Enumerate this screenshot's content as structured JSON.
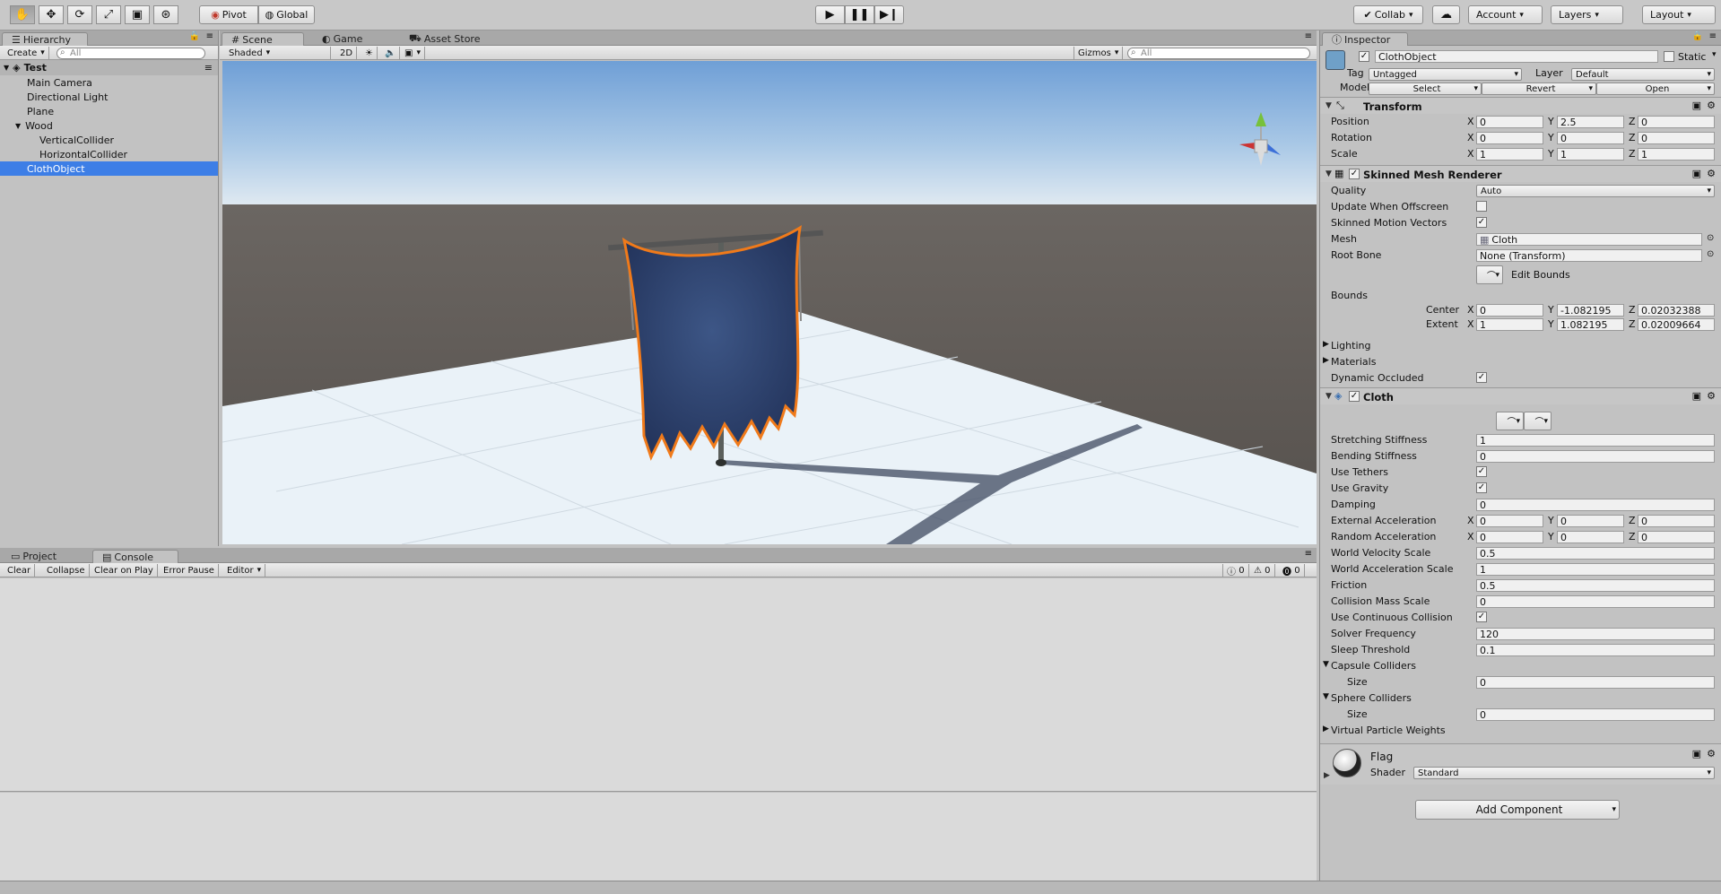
{
  "toolbar": {
    "tools": [
      "hand-tool",
      "move-tool",
      "rotate-tool",
      "scale-tool",
      "rect-tool",
      "transform-tool"
    ],
    "pivot_label": "Pivot",
    "global_label": "Global",
    "collab_label": "Collab",
    "account_label": "Account",
    "layers_label": "Layers",
    "layout_label": "Layout"
  },
  "hierarchy": {
    "tab_label": "Hierarchy",
    "create_label": "Create",
    "search_placeholder": "All",
    "scene_name": "Test",
    "items": [
      {
        "label": "Main Camera"
      },
      {
        "label": "Directional Light"
      },
      {
        "label": "Plane"
      },
      {
        "label": "Wood"
      },
      {
        "label": "VerticalCollider"
      },
      {
        "label": "HorizontalCollider"
      },
      {
        "label": "ClothObject"
      }
    ]
  },
  "scene_view": {
    "tabs": [
      {
        "label": "Scene"
      },
      {
        "label": "Game"
      },
      {
        "label": "Asset Store"
      }
    ],
    "shading_mode": "Shaded",
    "mode_2d": "2D",
    "gizmos_label": "Gizmos",
    "search_placeholder": "All",
    "gizmo_axes": [
      "x",
      "y",
      "z"
    ]
  },
  "bottom": {
    "tabs": [
      {
        "label": "Project"
      },
      {
        "label": "Console"
      }
    ],
    "buttons": {
      "clear": "Clear",
      "collapse": "Collapse",
      "clear_on_play": "Clear on Play",
      "error_pause": "Error Pause",
      "editor": "Editor"
    },
    "counts": {
      "info": "0",
      "warning": "0",
      "error": "0"
    }
  },
  "inspector": {
    "tab_label": "Inspector",
    "object_name": "ClothObject",
    "static_label": "Static",
    "tag_label": "Tag",
    "tag_value": "Untagged",
    "layer_label": "Layer",
    "layer_value": "Default",
    "model_label": "Model",
    "model_buttons": {
      "select": "Select",
      "revert": "Revert",
      "open": "Open"
    },
    "transform": {
      "title": "Transform",
      "position_label": "Position",
      "position": {
        "x": "0",
        "y": "2.5",
        "z": "0"
      },
      "rotation_label": "Rotation",
      "rotation": {
        "x": "0",
        "y": "0",
        "z": "0"
      },
      "scale_label": "Scale",
      "scale": {
        "x": "1",
        "y": "1",
        "z": "1"
      }
    },
    "skinned_mesh_renderer": {
      "title": "Skinned Mesh Renderer",
      "quality_label": "Quality",
      "quality_value": "Auto",
      "update_offscreen_label": "Update When Offscreen",
      "update_offscreen": "",
      "motion_vectors_label": "Skinned Motion Vectors",
      "motion_vectors": "✓",
      "mesh_label": "Mesh",
      "mesh_value": "Cloth",
      "root_bone_label": "Root Bone",
      "root_bone_value": "None (Transform)",
      "edit_bounds_label": "Edit Bounds",
      "bounds_label": "Bounds",
      "center_label": "Center",
      "center": {
        "x": "0",
        "y": "-1.082195",
        "z": "0.02032388"
      },
      "extent_label": "Extent",
      "extent": {
        "x": "1",
        "y": "1.082195",
        "z": "0.02009664"
      },
      "lighting_label": "Lighting",
      "materials_label": "Materials",
      "dynamic_occluded_label": "Dynamic Occluded",
      "dynamic_occluded": "✓"
    },
    "cloth": {
      "title": "Cloth",
      "stretching_label": "Stretching Stiffness",
      "stretching": "1",
      "bending_label": "Bending Stiffness",
      "bending": "0",
      "use_tethers_label": "Use Tethers",
      "use_tethers": "✓",
      "use_gravity_label": "Use Gravity",
      "use_gravity": "✓",
      "damping_label": "Damping",
      "damping": "0",
      "ext_accel_label": "External Acceleration",
      "ext_accel": {
        "x": "0",
        "y": "0",
        "z": "0"
      },
      "rand_accel_label": "Random Acceleration",
      "rand_accel": {
        "x": "0",
        "y": "0",
        "z": "0"
      },
      "world_vel_label": "World Velocity Scale",
      "world_vel": "0.5",
      "world_acc_label": "World Acceleration Scale",
      "world_acc": "1",
      "friction_label": "Friction",
      "friction": "0.5",
      "collision_mass_label": "Collision Mass Scale",
      "collision_mass": "0",
      "continuous_label": "Use Continuous Collision",
      "continuous": "✓",
      "solver_label": "Solver Frequency",
      "solver": "120",
      "sleep_label": "Sleep Threshold",
      "sleep": "0.1",
      "capsule_label": "Capsule Colliders",
      "capsule_size_label": "Size",
      "capsule_size": "0",
      "sphere_label": "Sphere Colliders",
      "sphere_size_label": "Size",
      "sphere_size": "0",
      "virtual_weights_label": "Virtual Particle Weights"
    },
    "material": {
      "name": "Flag",
      "shader_label": "Shader",
      "shader_value": "Standard"
    },
    "add_component_label": "Add Component"
  },
  "colors": {
    "selection": "#3d7ee6",
    "cloth_outline": "#f07a1a",
    "cloth_fill": "#2e4471",
    "sky_top": "#6f9fd6",
    "floor": "#e8f0f6"
  }
}
